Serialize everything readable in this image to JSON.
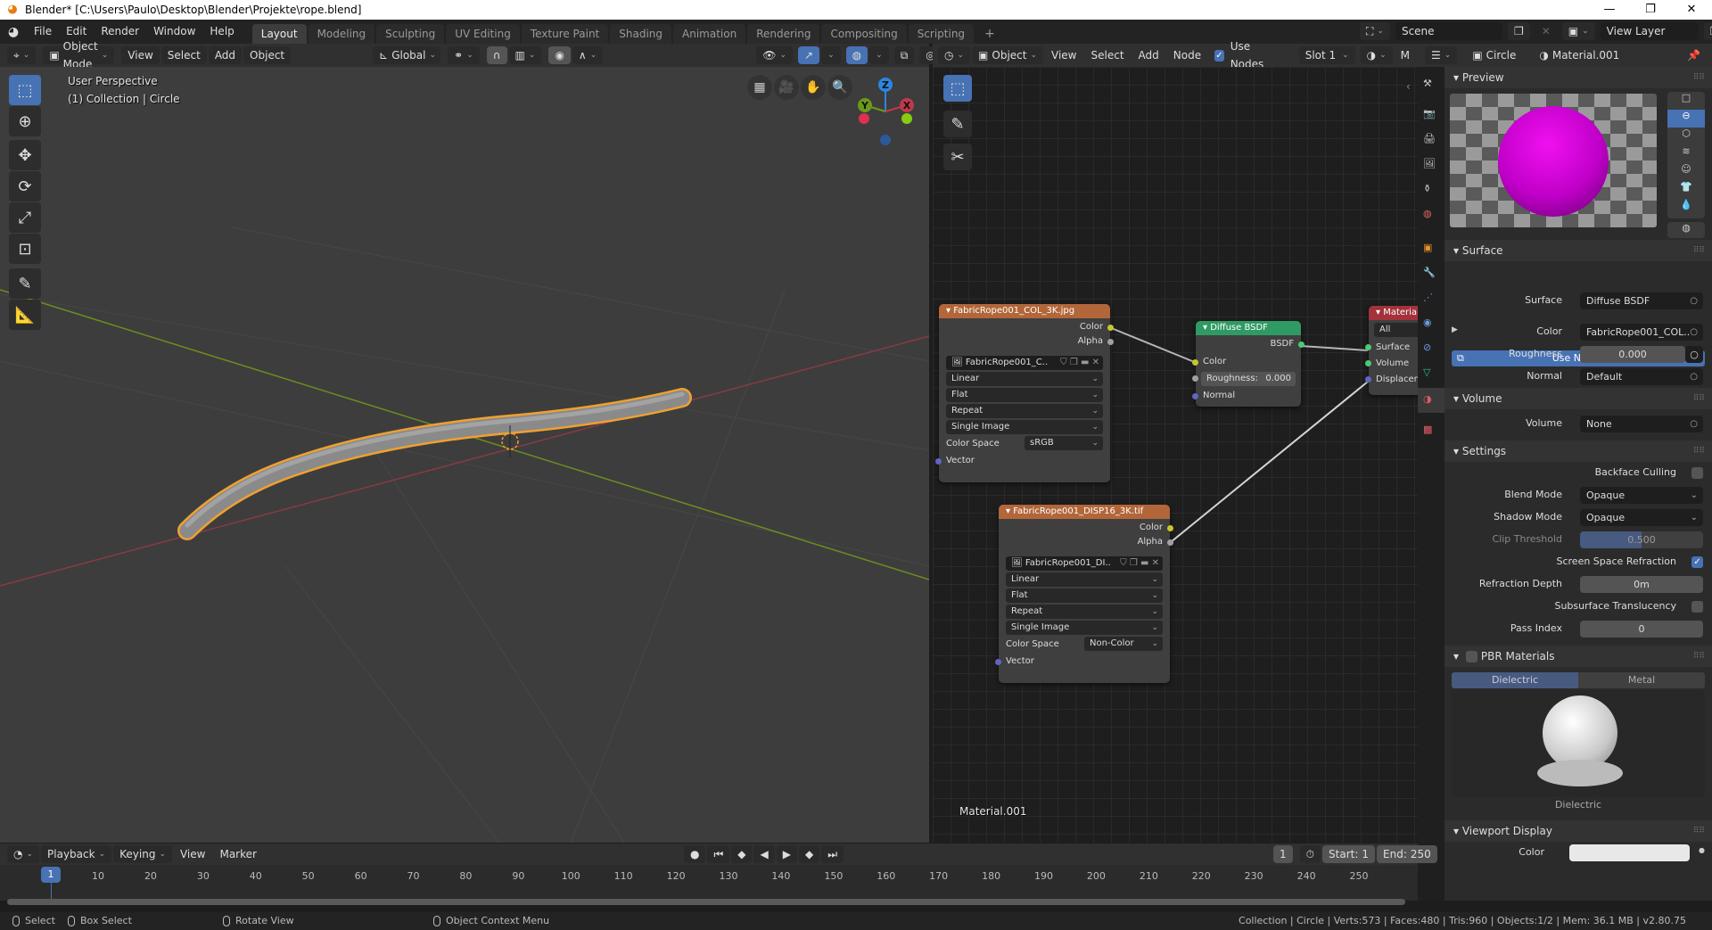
{
  "window": {
    "title": "Blender* [C:\\Users\\Paulo\\Desktop\\Blender\\Projekte\\rope.blend]",
    "minimize": "—",
    "maximize": "❐",
    "close": "✕"
  },
  "menu": [
    "File",
    "Edit",
    "Render",
    "Window",
    "Help"
  ],
  "workspaces": [
    {
      "label": "Layout",
      "active": true
    },
    {
      "label": "Modeling"
    },
    {
      "label": "Sculpting"
    },
    {
      "label": "UV Editing"
    },
    {
      "label": "Texture Paint"
    },
    {
      "label": "Shading"
    },
    {
      "label": "Animation"
    },
    {
      "label": "Rendering"
    },
    {
      "label": "Compositing"
    },
    {
      "label": "Scripting"
    }
  ],
  "add_workspace": "+",
  "scene": {
    "label": "Scene",
    "view_layer": "View Layer"
  },
  "viewport_header": {
    "mode": "Object Mode",
    "menus": [
      "View",
      "Select",
      "Add",
      "Object"
    ],
    "orientation": "Global"
  },
  "viewport": {
    "perspective": "User Perspective",
    "collection": "(1) Collection | Circle",
    "gizmo": {
      "x": "X",
      "y": "Y",
      "z": "Z"
    },
    "colors": {
      "x": "#c0394a",
      "y": "#6a9a1a",
      "z": "#2b86e0",
      "selected": "#f0a030"
    }
  },
  "node_header": {
    "type": "Object",
    "menus": [
      "View",
      "Select",
      "Add",
      "Node"
    ],
    "use_nodes_label": "Use Nodes",
    "use_nodes": true,
    "slot": "Slot 1",
    "extra": "M"
  },
  "nodes": {
    "image1": {
      "title": "FabricRope001_COL_3K.jpg",
      "out_color": "Color",
      "out_alpha": "Alpha",
      "image": "FabricRope001_C..",
      "interp": "Linear",
      "proj": "Flat",
      "ext": "Repeat",
      "source": "Single Image",
      "cs_label": "Color Space",
      "cs_value": "sRGB",
      "vector": "Vector"
    },
    "image2": {
      "title": "FabricRope001_DISP16_3K.tif",
      "out_color": "Color",
      "out_alpha": "Alpha",
      "image": "FabricRope001_DI..",
      "interp": "Linear",
      "proj": "Flat",
      "ext": "Repeat",
      "source": "Single Image",
      "cs_label": "Color Space",
      "cs_value": "Non-Color",
      "vector": "Vector"
    },
    "diffuse": {
      "title": "Diffuse BSDF",
      "out": "BSDF",
      "color": "Color",
      "rough_label": "Roughness:",
      "rough_value": "0.000",
      "normal": "Normal"
    },
    "output": {
      "title": "Material",
      "target": "All",
      "surface": "Surface",
      "volume": "Volume",
      "disp": "Displacen"
    },
    "material_name": "Material.001"
  },
  "props": {
    "object": "Circle",
    "material": "Material.001",
    "preview_title": "Preview",
    "surface_title": "Surface",
    "use_nodes_btn": "Use Nodes",
    "surface": {
      "label": "Surface",
      "value": "Diffuse BSDF"
    },
    "color": {
      "label": "Color",
      "value": "FabricRope001_COL.."
    },
    "roughness": {
      "label": "Roughness",
      "value": "0.000"
    },
    "normal": {
      "label": "Normal",
      "value": "Default"
    },
    "volume_title": "Volume",
    "volume": {
      "label": "Volume",
      "value": "None"
    },
    "settings_title": "Settings",
    "backface": {
      "label": "Backface Culling",
      "checked": false
    },
    "blend": {
      "label": "Blend Mode",
      "value": "Opaque"
    },
    "shadow": {
      "label": "Shadow Mode",
      "value": "Opaque"
    },
    "clip": {
      "label": "Clip Threshold",
      "value": "0.500",
      "fraction": 0.5
    },
    "ssr": {
      "label": "Screen Space Refraction",
      "checked": true
    },
    "refr_depth": {
      "label": "Refraction Depth",
      "value": "0m"
    },
    "sss": {
      "label": "Subsurface Translucency",
      "checked": false
    },
    "pass_index": {
      "label": "Pass Index",
      "value": "0"
    },
    "pbr_title": "PBR Materials",
    "pbr_tabs": [
      "Dielectric",
      "Metal"
    ],
    "pbr_caption": "Dielectric",
    "viewport_display_title": "Viewport Display",
    "vd_color_label": "Color"
  },
  "timeline": {
    "menus": [
      "Playback",
      "Keying",
      "View",
      "Marker"
    ],
    "current": "1",
    "start_label": "Start:",
    "start": "1",
    "end_label": "End:",
    "end": "250",
    "ticks": [
      "10",
      "20",
      "30",
      "40",
      "50",
      "60",
      "70",
      "80",
      "90",
      "100",
      "110",
      "120",
      "130",
      "140",
      "150",
      "160",
      "170",
      "180",
      "190",
      "200",
      "210",
      "220",
      "230",
      "240",
      "250"
    ]
  },
  "status": {
    "select": "Select",
    "box_select": "Box Select",
    "rotate": "Rotate View",
    "context": "Object Context Menu",
    "info": "Collection | Circle | Verts:573 | Faces:480 | Tris:960 | Objects:1/2 | Mem: 36.1 MB | v2.80.75"
  }
}
